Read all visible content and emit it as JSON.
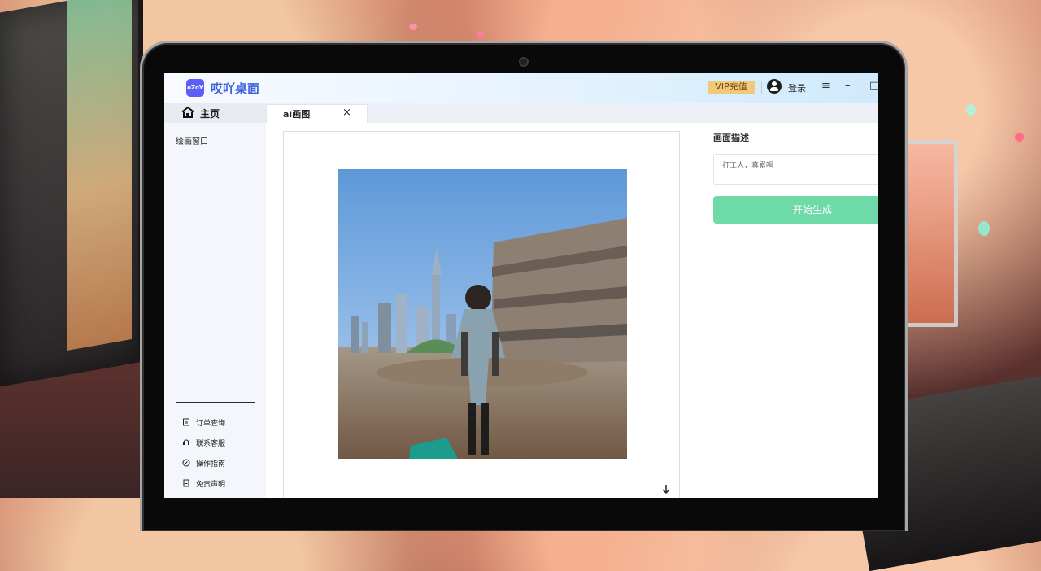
{
  "app": {
    "name": "哎吖桌面",
    "logo_text": "oZoY",
    "vip_label": "VIP充值",
    "login_label": "登录",
    "window_controls": [
      "≡",
      "–",
      "□"
    ]
  },
  "tabs": {
    "home_label": "主页",
    "active_tab_label": "ai画图",
    "close_label": "×"
  },
  "sidebar": {
    "primary_item": "绘画窗口",
    "bottom_items": [
      {
        "label": "订单查询",
        "icon": "order-icon"
      },
      {
        "label": "联系客服",
        "icon": "service-icon"
      },
      {
        "label": "操作指南",
        "icon": "guide-icon"
      },
      {
        "label": "免责声明",
        "icon": "disclaimer-icon"
      }
    ]
  },
  "panel": {
    "description_label": "画面描述",
    "description_value": "打工人，真累啊",
    "start_button_label": "开始生成"
  },
  "colors": {
    "accent_blue": "#3c63df",
    "vip_gold": "#f1c979",
    "button_green": "#6edaa8"
  }
}
